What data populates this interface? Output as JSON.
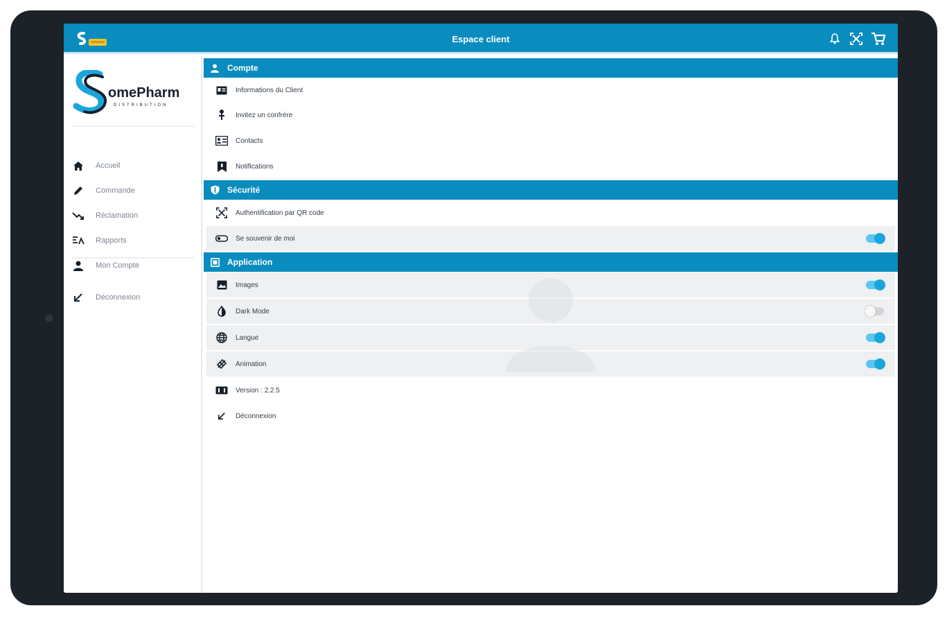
{
  "header": {
    "title": "Espace client",
    "app_logo_icon": "somepharm-app-icon",
    "actions": [
      {
        "icon": "bell-icon"
      },
      {
        "icon": "qr-scan-icon"
      },
      {
        "icon": "cart-icon"
      }
    ]
  },
  "brand": {
    "name": "omePharm",
    "subtitle": "DISTRIBUTION",
    "logo_icon": "somepharm-s-logo"
  },
  "sidebar": {
    "items": [
      {
        "label": "Accueil",
        "icon": "home-icon"
      },
      {
        "label": "Commande",
        "icon": "pencil-icon"
      },
      {
        "label": "Réclamation",
        "icon": "trend-down-icon"
      },
      {
        "label": "Rapports",
        "icon": "report-icon"
      },
      {
        "label": "Mon Compte",
        "icon": "person-icon"
      }
    ],
    "logout": {
      "label": "Déconnexion",
      "icon": "logout-icon"
    }
  },
  "sections": [
    {
      "label": "Compte",
      "icon": "person-icon",
      "rows": [
        {
          "label": "Informations du Client",
          "icon": "id-card-icon"
        },
        {
          "label": "Invitez un confrère",
          "icon": "invite-icon"
        },
        {
          "label": "Contacts",
          "icon": "contacts-icon"
        },
        {
          "label": "Notifications",
          "icon": "notification-flag-icon"
        }
      ]
    },
    {
      "label": "Sécurité",
      "icon": "shield-icon",
      "rows": [
        {
          "label": "Authentification par QR code",
          "icon": "qr-scan-icon"
        },
        {
          "label": "Se souvenir de moi",
          "icon": "remember-me-icon",
          "toggle": true
        }
      ]
    },
    {
      "label": "Application",
      "icon": "app-icon",
      "rows": [
        {
          "label": "Images",
          "icon": "image-icon",
          "toggle": true
        },
        {
          "label": "Dark Mode",
          "icon": "contrast-icon",
          "toggle": false
        },
        {
          "label": "Langue",
          "icon": "globe-icon",
          "toggle": true
        },
        {
          "label": "Animation",
          "icon": "animation-icon",
          "toggle": true
        },
        {
          "label": "Version : 2.2.5",
          "icon": "version-icon"
        },
        {
          "label": "Déconnexion",
          "icon": "logout-icon"
        }
      ]
    }
  ],
  "colors": {
    "primary": "#0a8cbf",
    "toggle_on": "#1aa6dd",
    "toggle_track": "#5cc6ef",
    "device_frame": "#1c2228",
    "accent_yellow": "#f2c230"
  }
}
